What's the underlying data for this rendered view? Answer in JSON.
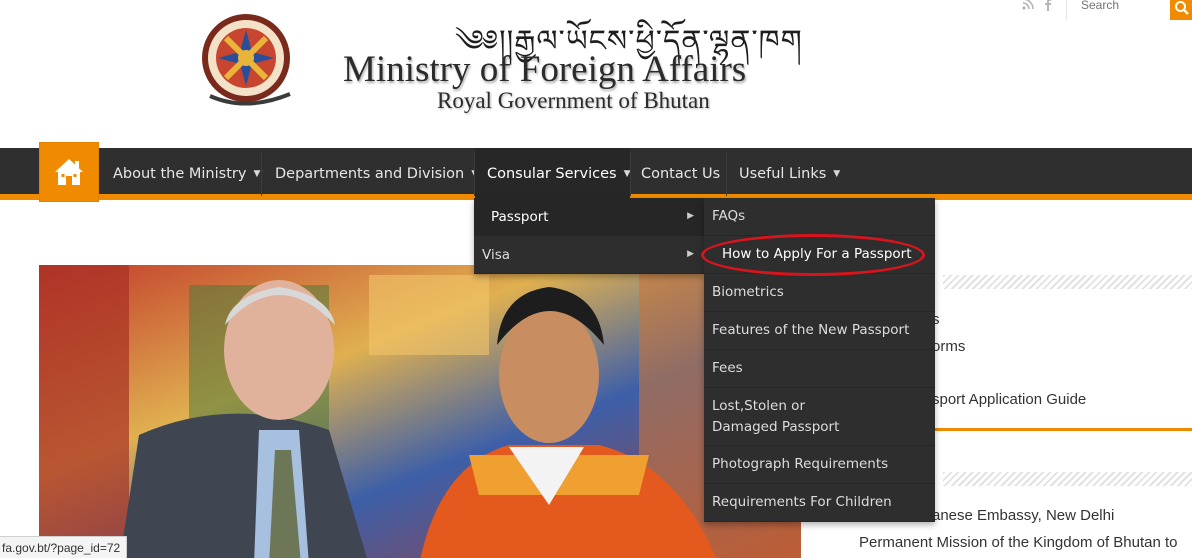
{
  "header": {
    "tibetan": "༄༅།།རྒྱལ་ཡོངས་ཕྱི་དོན་ལྷན་ཁག",
    "title": "Ministry of Foreign Affairs",
    "subtitle": "Royal Government of Bhutan"
  },
  "search": {
    "placeholder": "Search"
  },
  "nav": {
    "items": [
      {
        "label": "About the Ministry"
      },
      {
        "label": "Departments and Division"
      },
      {
        "label": "Consular Services"
      },
      {
        "label": "Contact Us"
      },
      {
        "label": "Useful Links"
      }
    ]
  },
  "consular_menu": {
    "items": [
      {
        "label": "Passport"
      },
      {
        "label": "Visa"
      }
    ]
  },
  "passport_menu": {
    "items": [
      {
        "label": "FAQs"
      },
      {
        "label": "How to Apply For a Passport"
      },
      {
        "label": "Biometrics"
      },
      {
        "label": "Features of the New Passport"
      },
      {
        "label": "Fees"
      },
      {
        "label": "Lost,Stolen or Damaged Passport"
      },
      {
        "label": "Photograph Requirements"
      },
      {
        "label": "Requirements For Children"
      }
    ]
  },
  "sidebar": {
    "line1": "s",
    "line2": "orms",
    "line3": "sport Application Guide",
    "line4": "anese Embassy, New Delhi",
    "line5": "Permanent Mission of the Kingdom of Bhutan to"
  },
  "status_bar": {
    "url": "fa.gov.bt/?page_id=72"
  },
  "colors": {
    "accent": "#f08a00",
    "nav_bg": "#2f2f2f",
    "highlight_circle": "#d9141d"
  }
}
